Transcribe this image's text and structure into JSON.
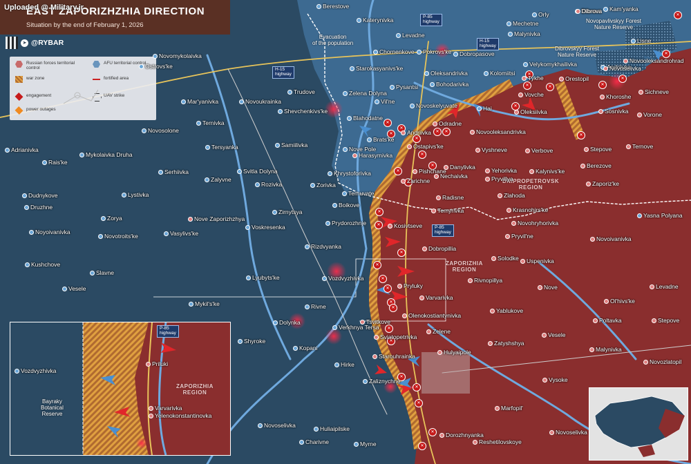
{
  "watermark": "Uploaded @ Military.ir",
  "header": {
    "title": "East Zaporizhzhia Direction",
    "subtitle": "Situation by the end of February 1, 2026",
    "brand": "@RYBAR",
    "bg_color": "#5a3024"
  },
  "legend": {
    "items": [
      {
        "label": "Russian forces territorial control",
        "icon": "russian-control-hex",
        "color": "#c86a6a"
      },
      {
        "label": "AFU territorial control",
        "icon": "afu-control-hex",
        "color": "#6a95bd"
      },
      {
        "label": "war zone",
        "icon": "war-zone-hatch",
        "color": "#e0a040"
      },
      {
        "label": "fortified area",
        "icon": "fortified-line",
        "color": "#c22"
      },
      {
        "label": "engagement",
        "icon": "engagement-diamond",
        "color": "#c61a1a"
      },
      {
        "label": "UAV strike",
        "icon": "uav-strike-icon",
        "color": "#333"
      },
      {
        "label": "power outages",
        "icon": "power-outage-icon",
        "color": "#f08a20"
      }
    ]
  },
  "colors": {
    "russian_control": "#8a2e2e",
    "afu_control": "#2b4a63",
    "afu_light": "#3e6d94",
    "water": "#6fa9de",
    "war_zone": "#e0a040",
    "engagement": "#c61a1a",
    "arrow_red": "#e0262a",
    "arrow_blue": "#4a8fd0"
  },
  "regions": [
    {
      "name": "DNIPROPETROVSK\nREGION"
    },
    {
      "name": "ZAPORIZHIA\nREGION"
    }
  ],
  "highways": [
    "P-85\nhighway",
    "H-15\nhighway",
    "H-15\nhighway",
    "P-85\nhighway"
  ],
  "notes": [
    "Evacuation\nof the population",
    "Novopavlivskyy Forest\nNature Reserve",
    "Dibrovskyy Forest\nNature Reserve"
  ],
  "settlements": [
    {
      "name": "Berestove",
      "side": "afu"
    },
    {
      "name": "Katerynivka",
      "side": "afu"
    },
    {
      "name": "Orly",
      "side": "afu"
    },
    {
      "name": "Dibrova",
      "side": "afu"
    },
    {
      "name": "Kam'yanka",
      "side": "afu"
    },
    {
      "name": "Mechetne",
      "side": "afu"
    },
    {
      "name": "Levadne",
      "side": "afu"
    },
    {
      "name": "Malynivka",
      "side": "afu"
    },
    {
      "name": "Lisne",
      "side": "afu"
    },
    {
      "name": "Chornenkove",
      "side": "afu"
    },
    {
      "name": "Pokrovs'ke",
      "side": "afu"
    },
    {
      "name": "Dobropasove",
      "side": "afu"
    },
    {
      "name": "Novomykolaivka",
      "side": "afu"
    },
    {
      "name": "Ostrovs'ke",
      "side": "afu"
    },
    {
      "name": "Starokasyanivs'ke",
      "side": "afu"
    },
    {
      "name": "Oleksandrivka",
      "side": "afu"
    },
    {
      "name": "Kolomiitsi",
      "side": "afu"
    },
    {
      "name": "Velykomykhailivka",
      "side": "afu"
    },
    {
      "name": "Andriivka",
      "side": "afu"
    },
    {
      "name": "Novoselivka",
      "side": "ru"
    },
    {
      "name": "Trudove",
      "side": "afu"
    },
    {
      "name": "Zelena Dolyna",
      "side": "afu"
    },
    {
      "name": "Pysantsi",
      "side": "afu"
    },
    {
      "name": "Bohodarivka",
      "side": "afu"
    },
    {
      "name": "Tykhe",
      "side": "ru"
    },
    {
      "name": "Orestopil",
      "side": "ru"
    },
    {
      "name": "Mar'yanivka",
      "side": "afu"
    },
    {
      "name": "Novoukrainka",
      "side": "afu"
    },
    {
      "name": "Vil'ne",
      "side": "afu"
    },
    {
      "name": "Novoskelyuvate",
      "side": "afu"
    },
    {
      "name": "Vovche",
      "side": "ru"
    },
    {
      "name": "Khoroshe",
      "side": "ru"
    },
    {
      "name": "Sichneve",
      "side": "ru"
    },
    {
      "name": "Shevchenkivs'ke",
      "side": "afu"
    },
    {
      "name": "Hai",
      "side": "afu"
    },
    {
      "name": "Oleksiivka",
      "side": "ru"
    },
    {
      "name": "Sosnivka",
      "side": "ru"
    },
    {
      "name": "Ternivka",
      "side": "afu"
    },
    {
      "name": "Blahodatne",
      "side": "afu"
    },
    {
      "name": "Andriivka",
      "side": "ru"
    },
    {
      "name": "Odradne",
      "side": "ru"
    },
    {
      "name": "Vorone",
      "side": "ru"
    },
    {
      "name": "Novosolone",
      "side": "afu"
    },
    {
      "name": "Novooleksandrivka",
      "side": "ru"
    },
    {
      "name": "Brats'ke",
      "side": "afu"
    },
    {
      "name": "Ostapivs'ke",
      "side": "ru"
    },
    {
      "name": "Tersyanka",
      "side": "afu"
    },
    {
      "name": "Samiilivka",
      "side": "afu"
    },
    {
      "name": "Nove Pole",
      "side": "afu"
    },
    {
      "name": "Vyshneve",
      "side": "ru"
    },
    {
      "name": "Verbove",
      "side": "ru"
    },
    {
      "name": "Stepove",
      "side": "ru"
    },
    {
      "name": "Ternove",
      "side": "ru"
    },
    {
      "name": "Adrianivka",
      "side": "afu"
    },
    {
      "name": "Mykolaivka Druha",
      "side": "afu"
    },
    {
      "name": "Harasymivka",
      "side": "ru"
    },
    {
      "name": "Rais'ke",
      "side": "afu"
    },
    {
      "name": "Serhiivka",
      "side": "afu"
    },
    {
      "name": "Svitla Dolyna",
      "side": "afu"
    },
    {
      "name": "Khrystoforivka",
      "side": "afu"
    },
    {
      "name": "Pishchane",
      "side": "ru"
    },
    {
      "name": "Danylivka",
      "side": "ru"
    },
    {
      "name": "Yehorivka",
      "side": "ru"
    },
    {
      "name": "Kalynivs'ke",
      "side": "ru"
    },
    {
      "name": "Berezove",
      "side": "ru"
    },
    {
      "name": "Zalyvne",
      "side": "afu"
    },
    {
      "name": "Zarichne",
      "side": "ru"
    },
    {
      "name": "Nechaivka",
      "side": "ru"
    },
    {
      "name": "Pryvillya",
      "side": "ru"
    },
    {
      "name": "Dudnykove",
      "side": "afu"
    },
    {
      "name": "Lystivka",
      "side": "afu"
    },
    {
      "name": "Rozivka",
      "side": "afu"
    },
    {
      "name": "Zorivka",
      "side": "afu"
    },
    {
      "name": "Zaporiz'ke",
      "side": "ru"
    },
    {
      "name": "Zlahoda",
      "side": "ru"
    },
    {
      "name": "Ternuvate",
      "side": "afu"
    },
    {
      "name": "Druzhne",
      "side": "afu"
    },
    {
      "name": "Zirnytsya",
      "side": "afu"
    },
    {
      "name": "Boikove",
      "side": "afu"
    },
    {
      "name": "Radisne",
      "side": "ru"
    },
    {
      "name": "Krasnohirs'ke",
      "side": "ru"
    },
    {
      "name": "Yasna Polyana",
      "side": "afu"
    },
    {
      "name": "Zorya",
      "side": "afu"
    },
    {
      "name": "Nove Zaporizhzhya",
      "side": "ru"
    },
    {
      "name": "Temyrivka",
      "side": "ru"
    },
    {
      "name": "Voskresenka",
      "side": "afu"
    },
    {
      "name": "Prydorozhnje",
      "side": "afu"
    },
    {
      "name": "Kosivtseve",
      "side": "ru"
    },
    {
      "name": "Novohryhorivka",
      "side": "ru"
    },
    {
      "name": "Noyoivanivka",
      "side": "afu"
    },
    {
      "name": "Vasylivs'ke",
      "side": "afu"
    },
    {
      "name": "Novotroits'ke",
      "side": "afu"
    },
    {
      "name": "Pryvil'ne",
      "side": "ru"
    },
    {
      "name": "Novoivanivka",
      "side": "ru"
    },
    {
      "name": "Rizdvyanka",
      "side": "afu"
    },
    {
      "name": "Dobropillia",
      "side": "ru"
    },
    {
      "name": "Kushchove",
      "side": "afu"
    },
    {
      "name": "Solodke",
      "side": "ru"
    },
    {
      "name": "Uspenivka",
      "side": "ru"
    },
    {
      "name": "Slavne",
      "side": "afu"
    },
    {
      "name": "Lyubyts'ke",
      "side": "afu"
    },
    {
      "name": "Vozdvyzhivka",
      "side": "afu"
    },
    {
      "name": "Pryluky",
      "side": "ru"
    },
    {
      "name": "Rivnopillya",
      "side": "ru"
    },
    {
      "name": "Vesele",
      "side": "afu"
    },
    {
      "name": "Nove",
      "side": "ru"
    },
    {
      "name": "Levadne",
      "side": "ru"
    },
    {
      "name": "Varvarivka",
      "side": "ru"
    },
    {
      "name": "Mykil's'ke",
      "side": "afu"
    },
    {
      "name": "Rivne",
      "side": "afu"
    },
    {
      "name": "Olenokostiantynivka",
      "side": "ru"
    },
    {
      "name": "Ol'hivs'ke",
      "side": "ru"
    },
    {
      "name": "Yablukove",
      "side": "ru"
    },
    {
      "name": "Tsvitkove",
      "side": "ru"
    },
    {
      "name": "Zelene",
      "side": "ru"
    },
    {
      "name": "Poltavka",
      "side": "ru"
    },
    {
      "name": "Stepove",
      "side": "ru"
    },
    {
      "name": "Dolynka",
      "side": "afu"
    },
    {
      "name": "Verkhnya Tersa",
      "side": "afu"
    },
    {
      "name": "Sviatopetrivka",
      "side": "ru"
    },
    {
      "name": "Zatyshshya",
      "side": "ru"
    },
    {
      "name": "Shyroke",
      "side": "afu"
    },
    {
      "name": "Kopani",
      "side": "afu"
    },
    {
      "name": "Vesele",
      "side": "ru"
    },
    {
      "name": "Starouhrainka",
      "side": "ru"
    },
    {
      "name": "Hulyaipole",
      "side": "ru"
    },
    {
      "name": "Malynivka",
      "side": "ru"
    },
    {
      "name": "Novozlatopil",
      "side": "ru"
    },
    {
      "name": "Hirke",
      "side": "afu"
    },
    {
      "name": "Zaliznychne",
      "side": "afu"
    },
    {
      "name": "Vysoke",
      "side": "ru"
    },
    {
      "name": "Marfopil'",
      "side": "ru"
    },
    {
      "name": "Huliaipilske",
      "side": "afu"
    },
    {
      "name": "Novoselivka",
      "side": "afu"
    },
    {
      "name": "Dorozhnyanka",
      "side": "ru"
    },
    {
      "name": "Charivne",
      "side": "afu"
    },
    {
      "name": "Myrne",
      "side": "afu"
    },
    {
      "name": "Reshetilovskoye",
      "side": "ru"
    },
    {
      "name": "Novoselivka",
      "side": "ru"
    },
    {
      "name": "Dibrova",
      "side": "ru"
    },
    {
      "name": "Novooleksandrohrad",
      "side": "ru"
    }
  ],
  "inset": {
    "region": "ZAPORIZHIA\nREGION",
    "highway": "P-85\nhighway",
    "reserve": "Bayraky\nBotanical\nReserve",
    "places": [
      "Vozdvyzhivka",
      "Priluki",
      "Varvarivka",
      "Yelenokonstantinovka"
    ]
  }
}
